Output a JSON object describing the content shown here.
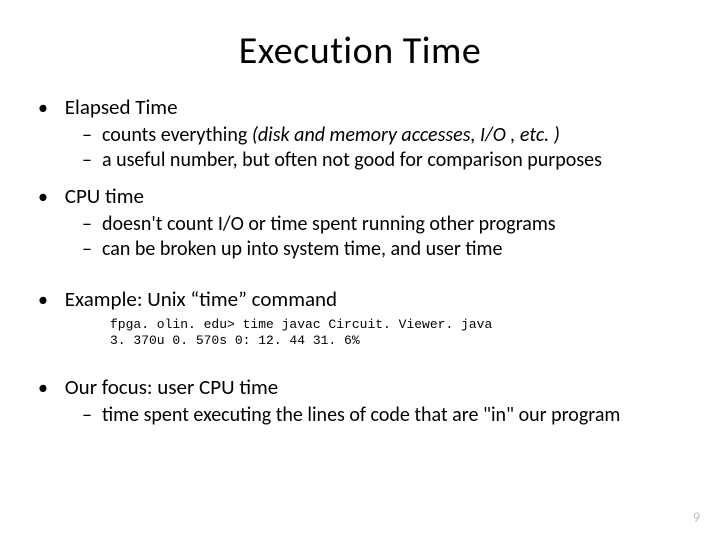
{
  "title": "Execution Time",
  "bullets": {
    "b0": {
      "label": "Elapsed Time",
      "s0a": "counts everything  ",
      "s0b": "(disk and memory accesses, I/O , etc. )",
      "s1": "a useful number, but often not good for comparison purposes"
    },
    "b1": {
      "label": "CPU time",
      "s0": "doesn't count I/O or time spent running other programs",
      "s1": "can be broken up into system time, and user time"
    },
    "b2": {
      "label": "Example: Unix “time” command",
      "code0": "fpga. olin. edu> time javac Circuit. Viewer. java",
      "code1": "3. 370u 0. 570s 0: 12. 44 31. 6%"
    },
    "b3": {
      "label": "Our focus:  user CPU time",
      "s0": "time spent executing the lines of code that are \"in\" our program"
    }
  },
  "page_number": "9"
}
